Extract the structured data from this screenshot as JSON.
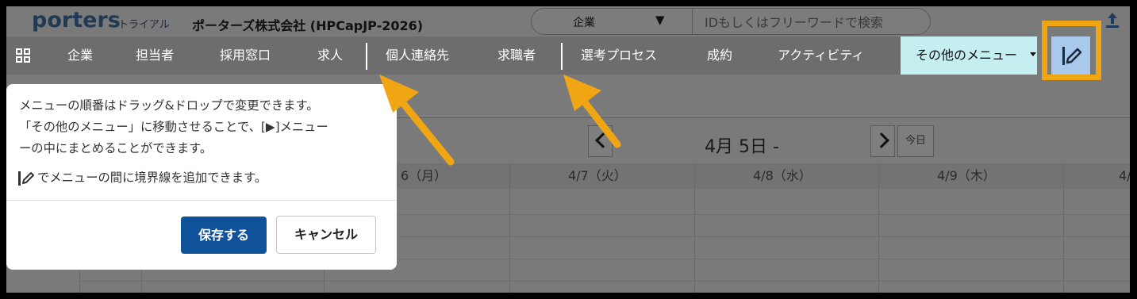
{
  "header": {
    "logo": "porters",
    "plan": "トライアル",
    "company": "ポーターズ株式会社 (HPCapJP-2026)",
    "search_scope": "企業",
    "search_placeholder": "IDもしくはフリーワードで検索"
  },
  "nav": {
    "items": [
      "企業",
      "担当者",
      "採用窓口",
      "求人",
      "個人連絡先",
      "求職者",
      "選考プロセス",
      "成約",
      "アクティビティ"
    ],
    "more_label": "その他のメニュー"
  },
  "calendar": {
    "date_range": "4月 5日 -",
    "today_label": "今日",
    "day_headers": [
      "6（月）",
      "4/7（火）",
      "4/8（水）",
      "4/9（木）",
      "4/"
    ]
  },
  "popup": {
    "line1": "メニューの順番はドラッグ&ドロップで変更できます。",
    "line2": "「その他のメニュー」に移動させることで、[▶]メニュー",
    "line3": "ーの中にまとめることができます。",
    "note": "でメニューの間に境界線を追加できます。",
    "save_label": "保存する",
    "cancel_label": "キャンセル"
  },
  "colors": {
    "accent": "#0f5299",
    "highlight": "#f0a613",
    "more_menu_bg": "#c4eef0",
    "edit_button_bg": "#a8c8ec"
  }
}
